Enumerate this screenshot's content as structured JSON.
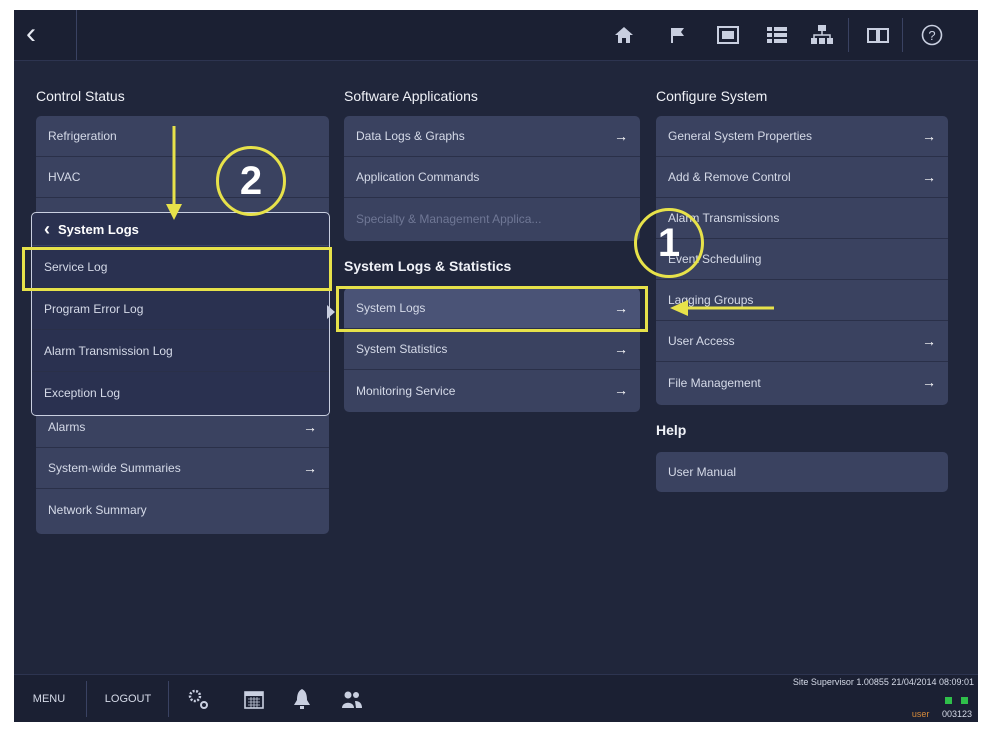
{
  "topbar": {
    "back_glyph": "‹",
    "icons": [
      "home-icon",
      "flag-icon",
      "screen-icon",
      "list-icon",
      "network-icon",
      "book-icon",
      "help-icon"
    ]
  },
  "columns": {
    "control_status": {
      "title": "Control Status",
      "items": [
        {
          "label": "Refrigeration"
        },
        {
          "label": "HVAC"
        },
        {
          "label": "Alarms",
          "arrow": "→"
        },
        {
          "label": "System-wide Summaries",
          "arrow": "→"
        },
        {
          "label": "Network Summary"
        }
      ]
    },
    "software_applications": {
      "title": "Software Applications",
      "items": [
        {
          "label": "Data Logs & Graphs",
          "arrow": "→"
        },
        {
          "label": "Application Commands"
        },
        {
          "label": "Specialty & Management Applica..."
        }
      ]
    },
    "system_logs_statistics": {
      "title": "System Logs & Statistics",
      "items": [
        {
          "label": "System Logs",
          "arrow": "→"
        },
        {
          "label": "System Statistics",
          "arrow": "→"
        },
        {
          "label": "Monitoring Service",
          "arrow": "→"
        }
      ]
    },
    "configure_system": {
      "title": "Configure System",
      "items": [
        {
          "label": "General System Properties",
          "arrow": "→"
        },
        {
          "label": "Add & Remove Control",
          "arrow": "→"
        },
        {
          "label": "Alarm Transmissions"
        },
        {
          "label": "Event Scheduling"
        },
        {
          "label": "Lagging Groups"
        },
        {
          "label": "User Access",
          "arrow": "→"
        },
        {
          "label": "File Management",
          "arrow": "→"
        }
      ]
    },
    "help": {
      "title": "Help",
      "items": [
        {
          "label": "User Manual"
        }
      ]
    }
  },
  "popup": {
    "back_glyph": "‹",
    "title": "System Logs",
    "items": [
      {
        "label": "Service Log"
      },
      {
        "label": "Program Error Log"
      },
      {
        "label": "Alarm Transmission Log"
      },
      {
        "label": "Exception Log"
      }
    ]
  },
  "annotations": {
    "step1": "1",
    "step2": "2",
    "color": "#e7e24a"
  },
  "bottombar": {
    "menu": "MENU",
    "logout": "LOGOUT",
    "icons": [
      "gears-icon",
      "calendar-icon",
      "bell-icon",
      "users-icon"
    ],
    "status_line": "Site Supervisor 1.00855 21/04/2014 08:09:01",
    "user_label": "user",
    "user_code": "003123"
  },
  "colors": {
    "background": "#20263b",
    "panel": "#3a4260",
    "highlight": "#e7e24a"
  }
}
